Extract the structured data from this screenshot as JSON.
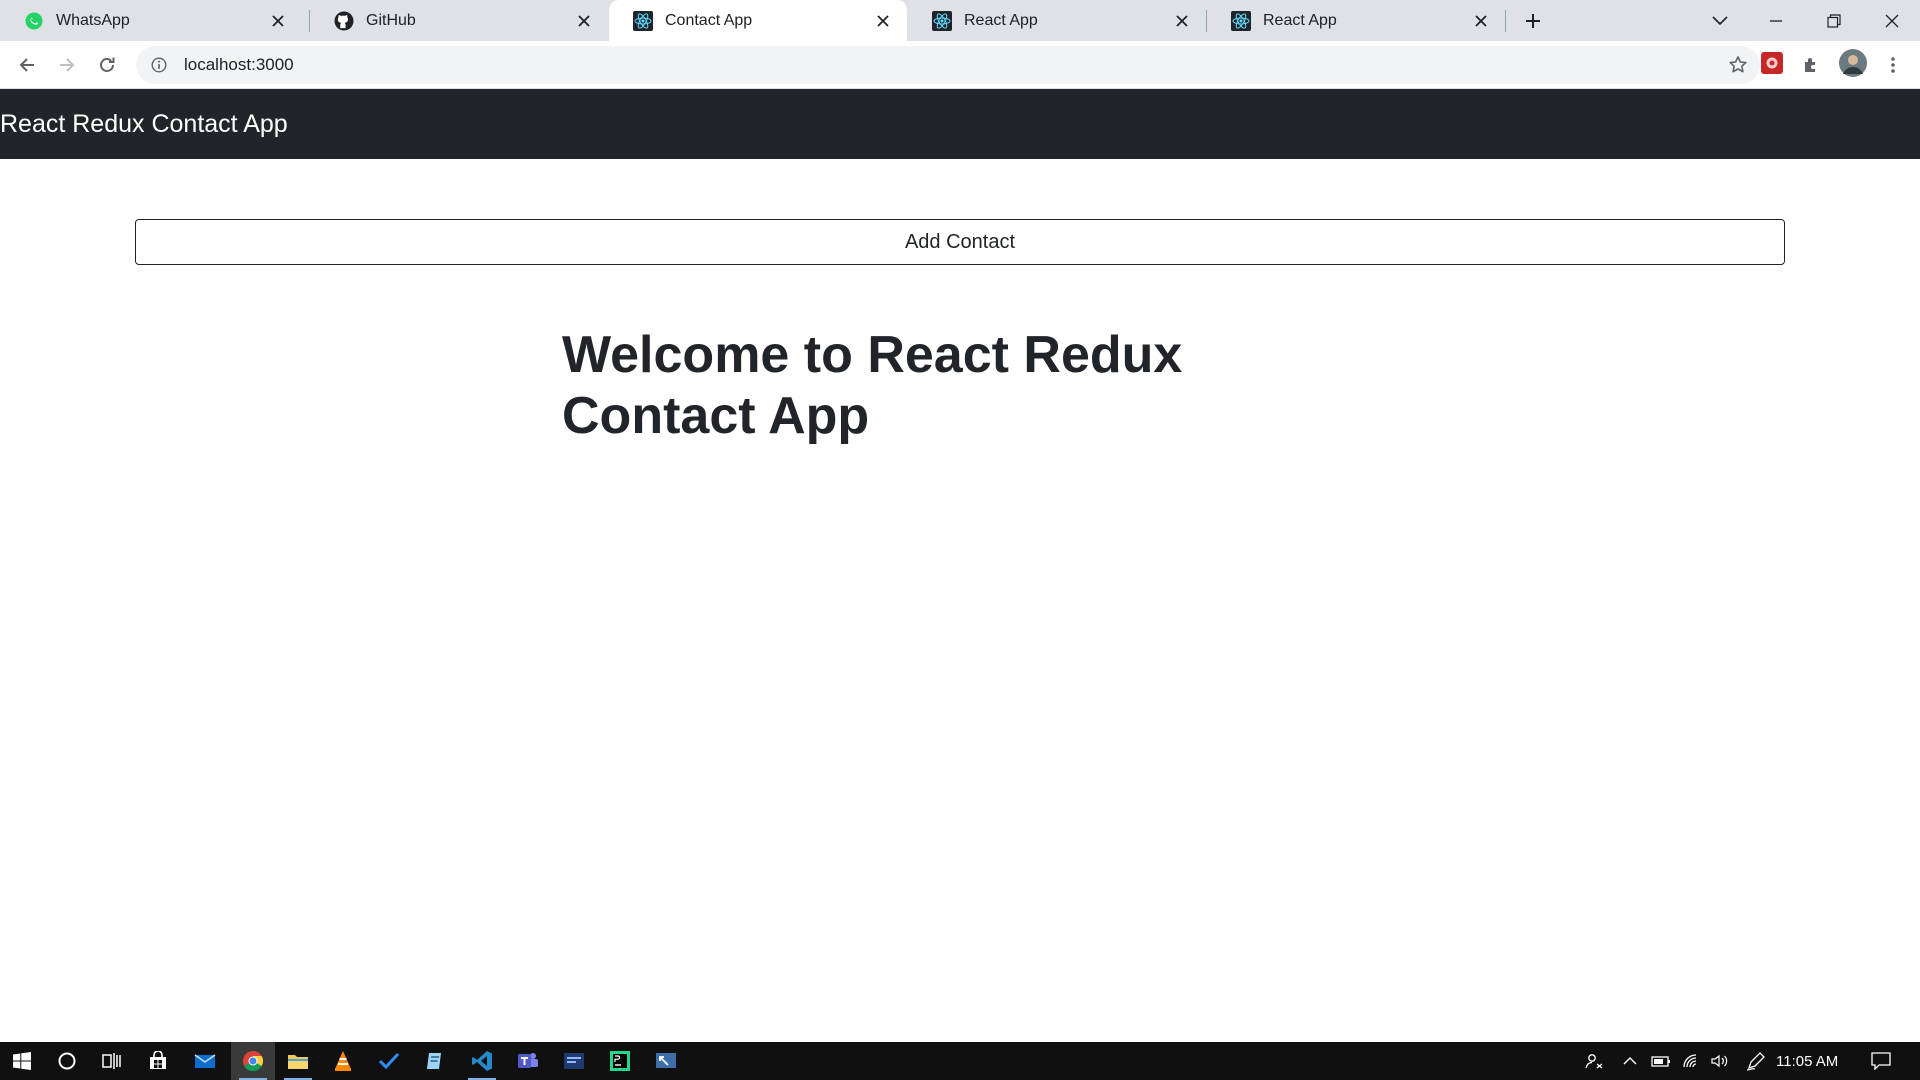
{
  "tabs": [
    {
      "title": "WhatsApp",
      "icon": "whatsapp-icon"
    },
    {
      "title": "GitHub",
      "icon": "github-icon"
    },
    {
      "title": "Contact App",
      "icon": "react-icon",
      "active": true
    },
    {
      "title": "React App",
      "icon": "react-icon"
    },
    {
      "title": "React App",
      "icon": "react-icon"
    }
  ],
  "address_bar": {
    "url": "localhost:3000"
  },
  "app": {
    "brand": "React Redux Contact App",
    "add_button_label": "Add Contact",
    "welcome_heading": "Welcome to React Redux Contact App"
  },
  "taskbar": {
    "time": "11:05 AM"
  },
  "colors": {
    "navbar_bg": "#212529",
    "tab_strip_bg": "#dee1e6",
    "taskbar_bg": "#101010"
  }
}
